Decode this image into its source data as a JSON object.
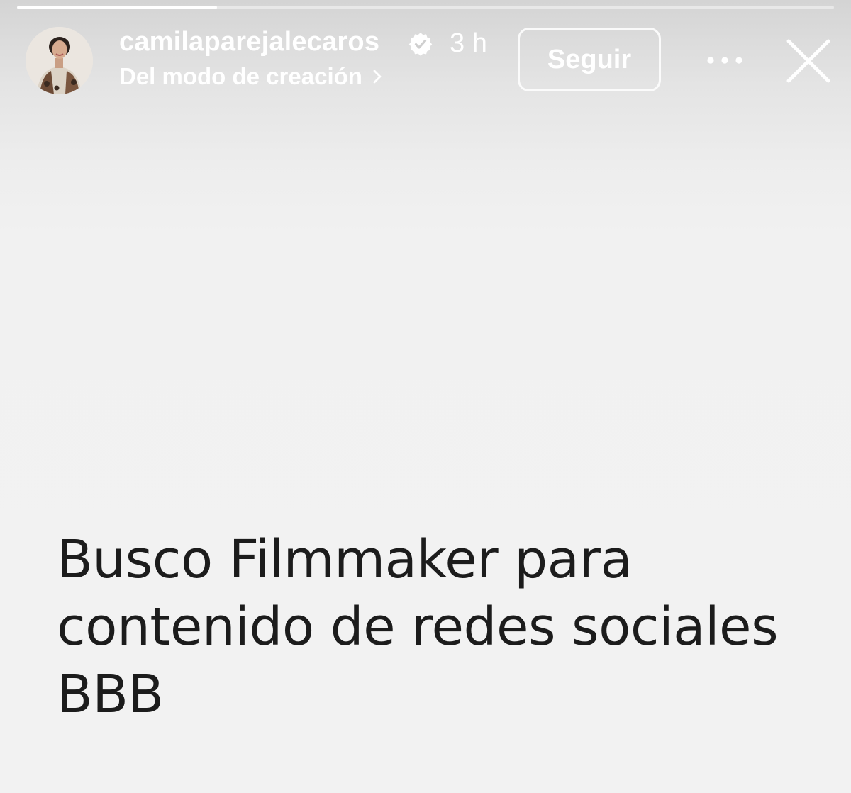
{
  "story": {
    "progress": 0.245,
    "header": {
      "username": "camilaparejalecaros",
      "verified": true,
      "timestamp": "3 h",
      "subtitle": "Del modo de creación",
      "follow_label": "Seguir"
    },
    "icons": {
      "verified": "verified-badge-icon",
      "subtitle_arrow": "chevron-right-icon",
      "more": "more-horizontal-icon",
      "close": "close-icon"
    },
    "text_lines": [
      "Busco Filmmaker para",
      "contenido de redes sociales",
      "BBB"
    ],
    "colors": {
      "text": "#1c1c1c",
      "header_text": "#ffffff",
      "background": "#f1f1f1"
    }
  }
}
